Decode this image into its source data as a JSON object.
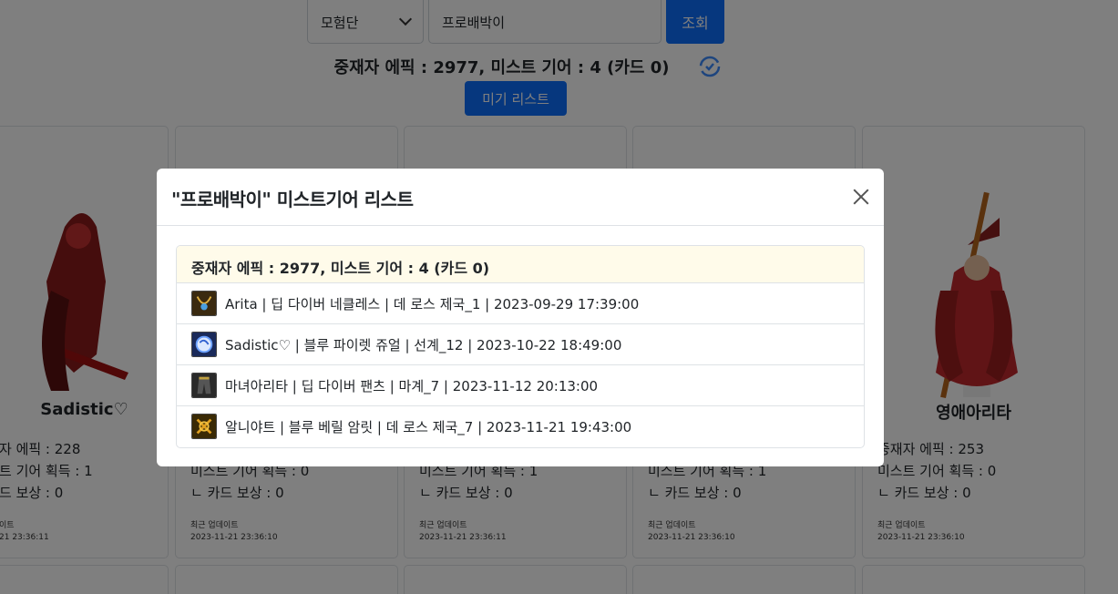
{
  "search": {
    "category": "모험단",
    "query": "프로배박이",
    "button_label": "조회"
  },
  "summary": "중재자 에픽 : 2977, 미스트 기어 : 4 (카드 0)",
  "list_button_label": "미기 리스트",
  "cards": [
    {
      "name": "Sadistic♡",
      "epic": "자 에픽 : 228",
      "mist": "트 기어 획득 : 1",
      "card": "드 보상 : 0",
      "updated_label": "이트",
      "updated_time": "21 23:36:11"
    },
    {
      "name": "",
      "epic": "",
      "mist": "미스트 기어 획득 : 0",
      "card": "ㄴ 카드 보상 : 0",
      "updated_label": "최근 업데이트",
      "updated_time": "2023-11-21 23:36:10"
    },
    {
      "name": "",
      "epic": "",
      "mist": "미스트 기어 획득 : 1",
      "card": "ㄴ 카드 보상 : 0",
      "updated_label": "최근 업데이트",
      "updated_time": "2023-11-21 23:36:11"
    },
    {
      "name": "",
      "epic": "",
      "mist": "미스트 기어 획득 : 1",
      "card": "ㄴ 카드 보상 : 0",
      "updated_label": "최근 업데이트",
      "updated_time": "2023-11-21 23:36:10"
    },
    {
      "name": "영애아리타",
      "epic": "중재자 에픽 : 253",
      "mist": "미스트 기어 획득 : 0",
      "card": "ㄴ 카드 보상 : 0",
      "updated_label": "최근 업데이트",
      "updated_time": "2023-11-21 23:36:10"
    }
  ],
  "modal": {
    "title": "\"프로배박이\" 미스트기어 리스트",
    "list_header": "중재자 에픽 : 2977, 미스트 기어 : 4 (카드 0)",
    "items": [
      {
        "icon": "necklace-icon",
        "text": "Arita | 딥 다이버 네클레스 | 데 로스 제국_1 | 2023-09-29 17:39:00"
      },
      {
        "icon": "jewel-icon",
        "text": "Sadistic♡ | 블루 파이렛 쥬얼 | 선계_12 | 2023-10-22 18:49:00"
      },
      {
        "icon": "pants-icon",
        "text": "마녀아리타 | 딥 다이버 팬츠 | 마계_7 | 2023-11-12 20:13:00"
      },
      {
        "icon": "amulet-icon",
        "text": "알니야트 | 블루 베릴 암릿 | 데 로스 제국_7 | 2023-11-21 19:43:00"
      }
    ]
  },
  "colors": {
    "primary": "#0d6efd",
    "list_header_bg": "#fffbea",
    "backdrop": "rgba(0,0,0,0.5)"
  }
}
